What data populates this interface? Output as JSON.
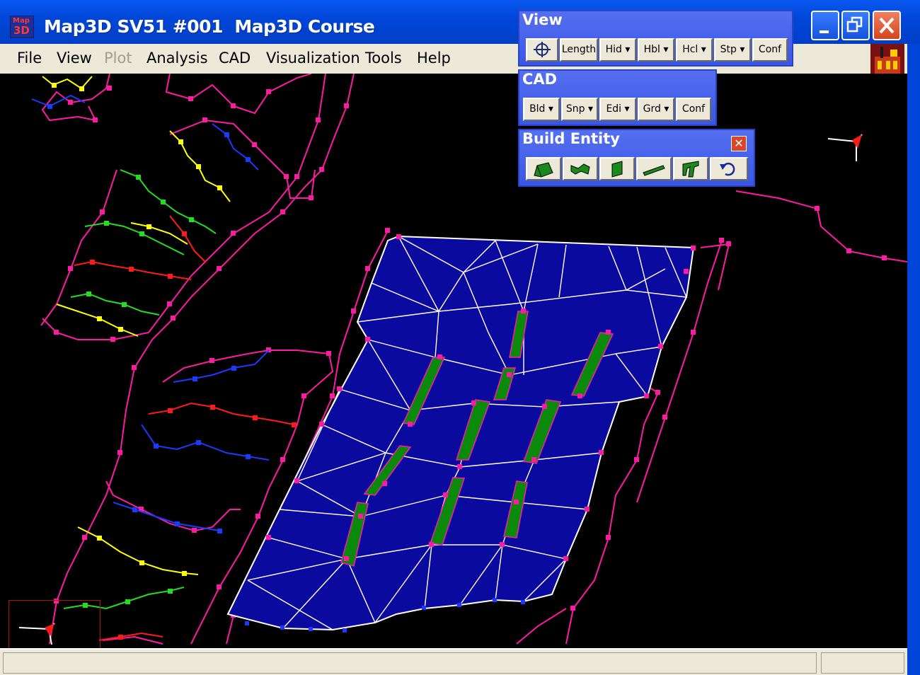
{
  "window": {
    "title": "Map3D SV51 #001  Map3D Course",
    "icon_top": "Map",
    "icon_bottom": "3D"
  },
  "window_controls": {
    "minimize": "minimize-icon",
    "maximize": "restore-icon",
    "close": "close-icon"
  },
  "menu": [
    {
      "label": "File",
      "enabled": true
    },
    {
      "label": "View",
      "enabled": true
    },
    {
      "label": "Plot",
      "enabled": false
    },
    {
      "label": "Analysis",
      "enabled": true
    },
    {
      "label": "CAD",
      "enabled": true
    },
    {
      "label": "Visualization",
      "enabled": true
    },
    {
      "label": "Tools",
      "enabled": true
    },
    {
      "label": "Help",
      "enabled": true
    }
  ],
  "toolbar_view": {
    "title": "View",
    "buttons": [
      "crosshair-icon",
      "Length",
      "Hid",
      "Hbl",
      "Hcl",
      "Stp",
      "Conf"
    ]
  },
  "toolbar_cad": {
    "title": "CAD",
    "buttons": [
      "Bld",
      "Snp",
      "Edi",
      "Grd",
      "Conf"
    ]
  },
  "toolbar_build": {
    "title": "Build Entity",
    "buttons": [
      "solid-block-icon",
      "surface-icon",
      "plane-icon",
      "line-icon",
      "tunnel-icon",
      "undo-icon"
    ]
  },
  "colors": {
    "mesh_fill": "#0a0a9f",
    "mesh_lines": "#ffffff",
    "magenta": "#ff1aa3",
    "ore_green": "#0a8a0a",
    "series_red": "#ff1a1a",
    "series_blue": "#1a3aff",
    "series_yellow": "#ffff00",
    "series_green": "#22dd22"
  },
  "status": {
    "main": "",
    "right": ""
  }
}
